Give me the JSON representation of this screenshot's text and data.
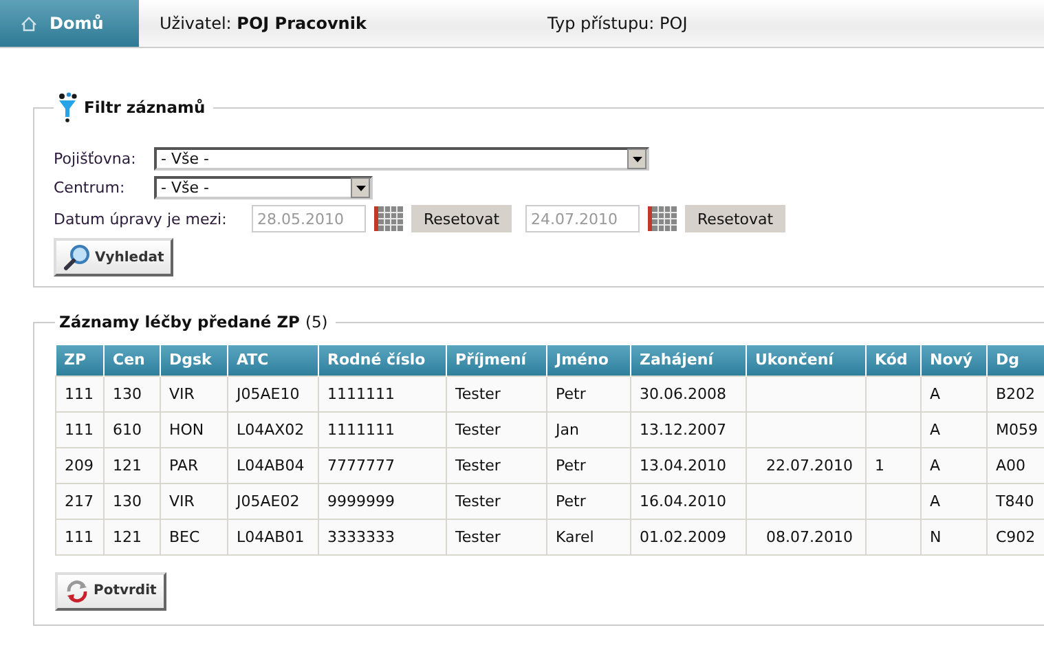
{
  "header": {
    "home_tab": {
      "label": "Domů",
      "selected": true
    },
    "user_label": "Uživatel:",
    "user_name": "POJ Pracovnik",
    "access_label": "Typ přístupu:",
    "access_value": "POJ"
  },
  "filter": {
    "title": "Filtr záznamů",
    "fields": [
      {
        "label": "Pojišťovna:",
        "value": "- Vše -",
        "wide": true
      },
      {
        "label": "Centrum:",
        "value": "- Vše -",
        "wide": false
      }
    ],
    "date_label": "Datum úpravy je mezi:",
    "dates": [
      {
        "placeholder": "28.05.2010",
        "reset": "Resetovat"
      },
      {
        "placeholder": "24.07.2010",
        "reset": "Resetovat"
      }
    ],
    "search_button": "Vyhledat"
  },
  "records": {
    "title": "Záznamy léčby předané ZP",
    "count": "(5)",
    "columns": [
      "ZP",
      "Cen",
      "Dgsk",
      "ATC",
      "Rodné číslo",
      "Příjmení",
      "Jméno",
      "Zahájení",
      "Ukončení",
      "Kód",
      "Nový",
      "Dg"
    ],
    "rows": [
      [
        "111",
        "130",
        "VIR",
        "J05AE10",
        "1111111",
        "Tester",
        "Petr",
        "30.06.2008",
        "",
        "",
        "A",
        "B202"
      ],
      [
        "111",
        "610",
        "HON",
        "L04AX02",
        "1111111",
        "Tester",
        "Jan",
        "13.12.2007",
        "",
        "",
        "A",
        "M059"
      ],
      [
        "209",
        "121",
        "PAR",
        "L04AB04",
        "7777777",
        "Tester",
        "Petr",
        "13.04.2010",
        "22.07.2010",
        "1",
        "A",
        "A00"
      ],
      [
        "217",
        "130",
        "VIR",
        "J05AE02",
        "9999999",
        "Tester",
        "Petr",
        "16.04.2010",
        "",
        "",
        "A",
        "T840"
      ],
      [
        "111",
        "121",
        "BEC",
        "L04AB01",
        "3333333",
        "Tester",
        "Karel",
        "01.02.2009",
        "08.07.2010",
        "",
        "N",
        "C902"
      ]
    ],
    "confirm_button": "Potvrdit"
  }
}
